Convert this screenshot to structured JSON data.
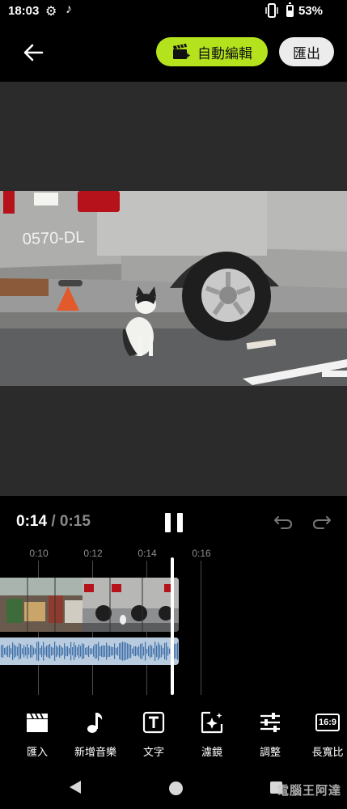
{
  "status_bar": {
    "time": "18:03",
    "icons": [
      "gear-icon",
      "music-note-icon",
      "vibrate-icon",
      "battery-icon"
    ],
    "battery_level": 0.53,
    "battery": "53%"
  },
  "header": {
    "back_icon": "arrow-left-icon",
    "auto_edit_label": "自動編輯",
    "auto_edit_icon": "clapperboard-sparkle-icon",
    "export_label": "匯出",
    "accent_color": "#b4e31e"
  },
  "playback": {
    "current_time": "0:14",
    "separator": "/",
    "total_time": "0:15",
    "state_icon": "pause-icon"
  },
  "history": {
    "undo_icon": "undo-icon",
    "redo_icon": "redo-icon"
  },
  "timeline": {
    "ticks": [
      "0:10",
      "0:12",
      "0:14",
      "0:16"
    ]
  },
  "toolbar": {
    "items": [
      {
        "label": "匯入",
        "icon": "clapperboard-icon"
      },
      {
        "label": "新增音樂",
        "icon": "music-note-icon"
      },
      {
        "label": "文字",
        "icon": "text-box-icon"
      },
      {
        "label": "濾鏡",
        "icon": "sparkle-filter-icon"
      },
      {
        "label": "調整",
        "icon": "sliders-icon"
      },
      {
        "label": "長寬比",
        "icon": "aspect-ratio-icon",
        "badge": "16:9"
      }
    ]
  },
  "nav_bar": {
    "icons": [
      "nav-back-icon",
      "nav-home-icon",
      "nav-recents-icon"
    ]
  },
  "watermark": "電腦王阿達"
}
